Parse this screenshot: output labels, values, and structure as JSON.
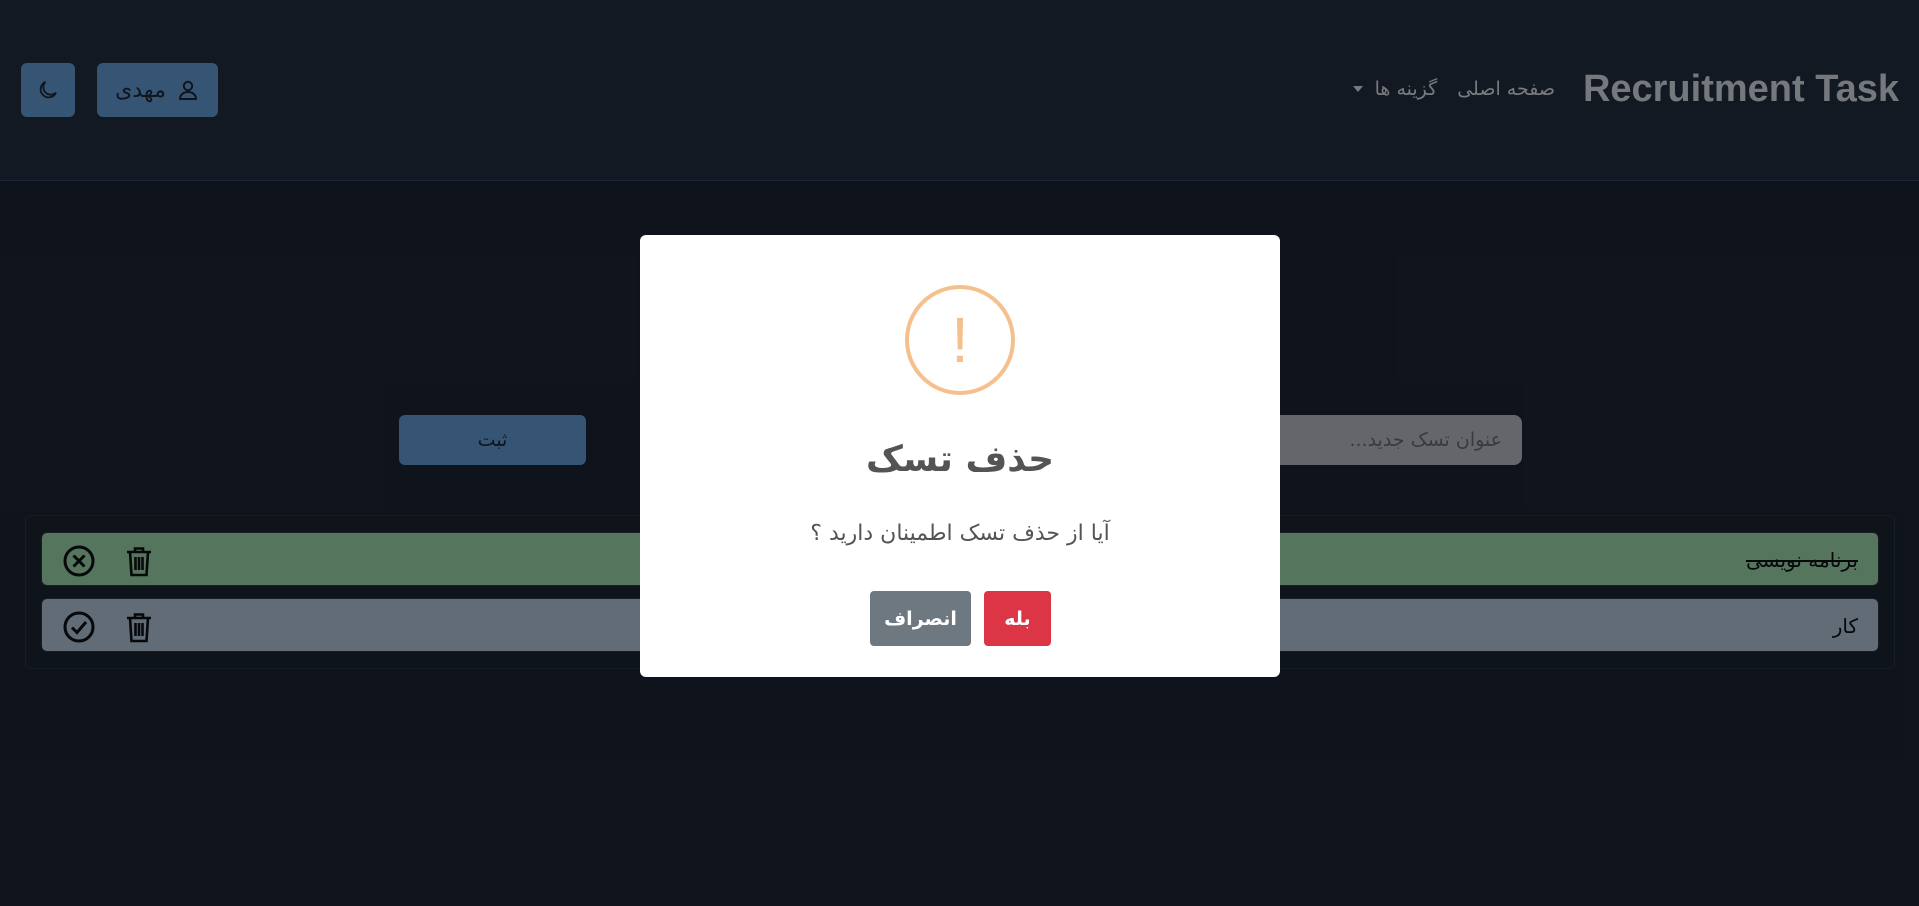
{
  "header": {
    "brand": "Recruitment Task",
    "nav_home": "صفحه اصلی",
    "nav_options": "گزینه ها",
    "user_name": "مهدی",
    "user_icon": "user-icon",
    "theme_icon": "moon-icon"
  },
  "form": {
    "placeholder": "عنوان تسک جدید...",
    "submit_label": "ثبت"
  },
  "tasks": [
    {
      "title": "برنامه نویسی",
      "completed": true,
      "toggle_icon": "x-circle-icon",
      "delete_icon": "trash-icon"
    },
    {
      "title": "کار",
      "completed": false,
      "toggle_icon": "check-circle-icon",
      "delete_icon": "trash-icon"
    }
  ],
  "modal": {
    "icon": "!",
    "icon_name": "warning-icon",
    "title": "حذف تسک",
    "text": "آیا از حذف تسک اطمینان دارید ؟",
    "confirm_label": "بله",
    "cancel_label": "انصراف"
  },
  "colors": {
    "background": "#1a2130",
    "navbar": "#212a3a",
    "primary": "#5a8ec2",
    "done_row": "#8fc49c",
    "todo_row": "#a3b4c6",
    "warning": "#f5c08e",
    "confirm": "#dc3545",
    "cancel": "#6e7881"
  }
}
